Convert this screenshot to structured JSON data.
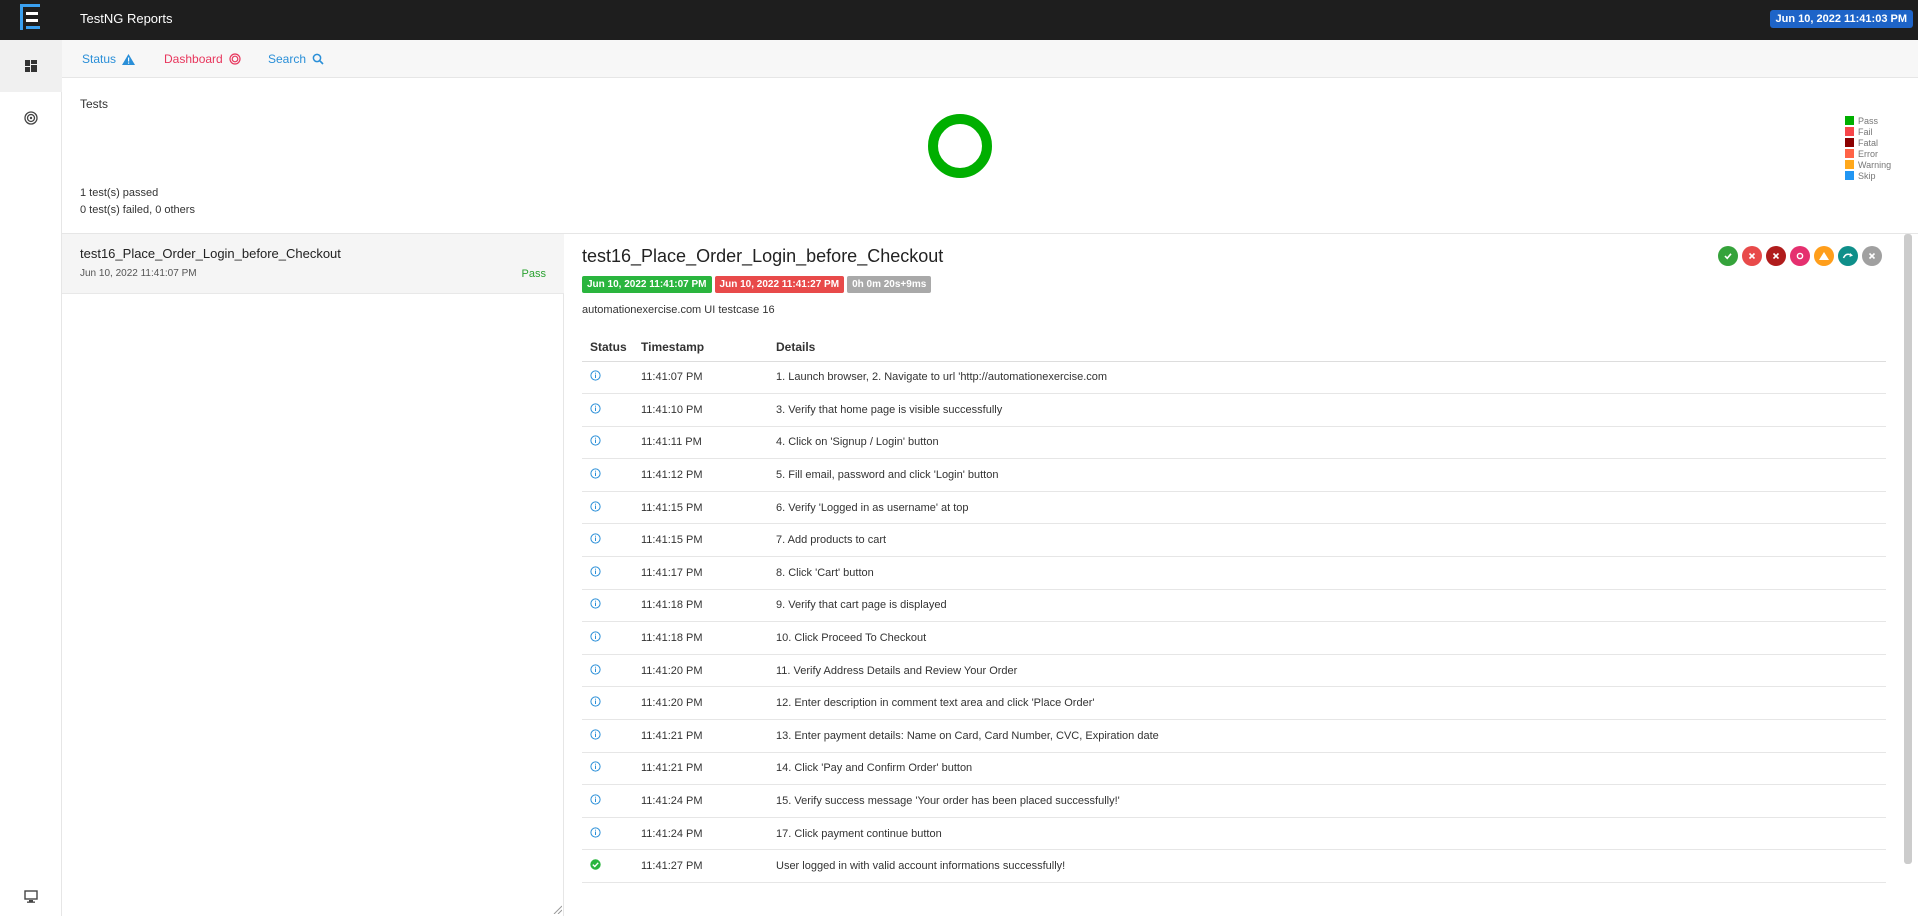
{
  "app": {
    "title": "TestNG Reports",
    "date_badge": "Jun 10, 2022 11:41:03 PM"
  },
  "subnav": {
    "status_label": "Status",
    "dashboard_label": "Dashboard",
    "search_label": "Search"
  },
  "summary": {
    "title": "Tests",
    "passed_text": "1 test(s) passed",
    "failed_text": "0 test(s) failed, 0 others",
    "pass_fraction": 1.0,
    "legend": [
      {
        "label": "Pass",
        "color": "#00af00"
      },
      {
        "label": "Fail",
        "color": "#f7464a"
      },
      {
        "label": "Fatal",
        "color": "#8b0000"
      },
      {
        "label": "Error",
        "color": "#ff6347"
      },
      {
        "label": "Warning",
        "color": "#ffa81c"
      },
      {
        "label": "Skip",
        "color": "#2196f3"
      }
    ]
  },
  "test_list": [
    {
      "name": "test16_Place_Order_Login_before_Checkout",
      "time": "Jun 10, 2022 11:41:07 PM",
      "status": "Pass"
    }
  ],
  "detail": {
    "title": "test16_Place_Order_Login_before_Checkout",
    "start_badge": "Jun 10, 2022 11:41:07 PM",
    "end_badge": "Jun 10, 2022 11:41:27 PM",
    "duration_badge": "0h 0m 20s+9ms",
    "description": "automationexercise.com UI testcase 16",
    "filter_icons": [
      {
        "name": "pass",
        "color": "#35a33b",
        "icon": "check"
      },
      {
        "name": "fail",
        "color": "#e84a4a",
        "icon": "x"
      },
      {
        "name": "fatal",
        "color": "#b01c1c",
        "icon": "x"
      },
      {
        "name": "error",
        "color": "#e5306f",
        "icon": "dot"
      },
      {
        "name": "warning",
        "color": "#ff9e1b",
        "icon": "triangle"
      },
      {
        "name": "skip",
        "color": "#0f8f8a",
        "icon": "arrow"
      },
      {
        "name": "clear",
        "color": "#a0a0a0",
        "icon": "x"
      }
    ],
    "columns": {
      "status": "Status",
      "timestamp": "Timestamp",
      "details": "Details"
    },
    "logs": [
      {
        "status": "info",
        "time": "11:41:07 PM",
        "details": "1. Launch browser, 2. Navigate to url 'http://automationexercise.com"
      },
      {
        "status": "info",
        "time": "11:41:10 PM",
        "details": "3. Verify that home page is visible successfully"
      },
      {
        "status": "info",
        "time": "11:41:11 PM",
        "details": "4. Click on 'Signup / Login' button"
      },
      {
        "status": "info",
        "time": "11:41:12 PM",
        "details": "5. Fill email, password and click 'Login' button"
      },
      {
        "status": "info",
        "time": "11:41:15 PM",
        "details": "6. Verify 'Logged in as username' at top"
      },
      {
        "status": "info",
        "time": "11:41:15 PM",
        "details": "7. Add products to cart"
      },
      {
        "status": "info",
        "time": "11:41:17 PM",
        "details": "8. Click 'Cart' button"
      },
      {
        "status": "info",
        "time": "11:41:18 PM",
        "details": "9. Verify that cart page is displayed"
      },
      {
        "status": "info",
        "time": "11:41:18 PM",
        "details": "10. Click Proceed To Checkout"
      },
      {
        "status": "info",
        "time": "11:41:20 PM",
        "details": "11. Verify Address Details and Review Your Order"
      },
      {
        "status": "info",
        "time": "11:41:20 PM",
        "details": "12. Enter description in comment text area and click 'Place Order'"
      },
      {
        "status": "info",
        "time": "11:41:21 PM",
        "details": "13. Enter payment details: Name on Card, Card Number, CVC, Expiration date"
      },
      {
        "status": "info",
        "time": "11:41:21 PM",
        "details": "14. Click 'Pay and Confirm Order' button"
      },
      {
        "status": "info",
        "time": "11:41:24 PM",
        "details": "15. Verify success message 'Your order has been placed successfully!'"
      },
      {
        "status": "info",
        "time": "11:41:24 PM",
        "details": "17. Click payment continue button"
      },
      {
        "status": "pass",
        "time": "11:41:27 PM",
        "details": "User logged in with valid account informations successfully!"
      }
    ]
  }
}
